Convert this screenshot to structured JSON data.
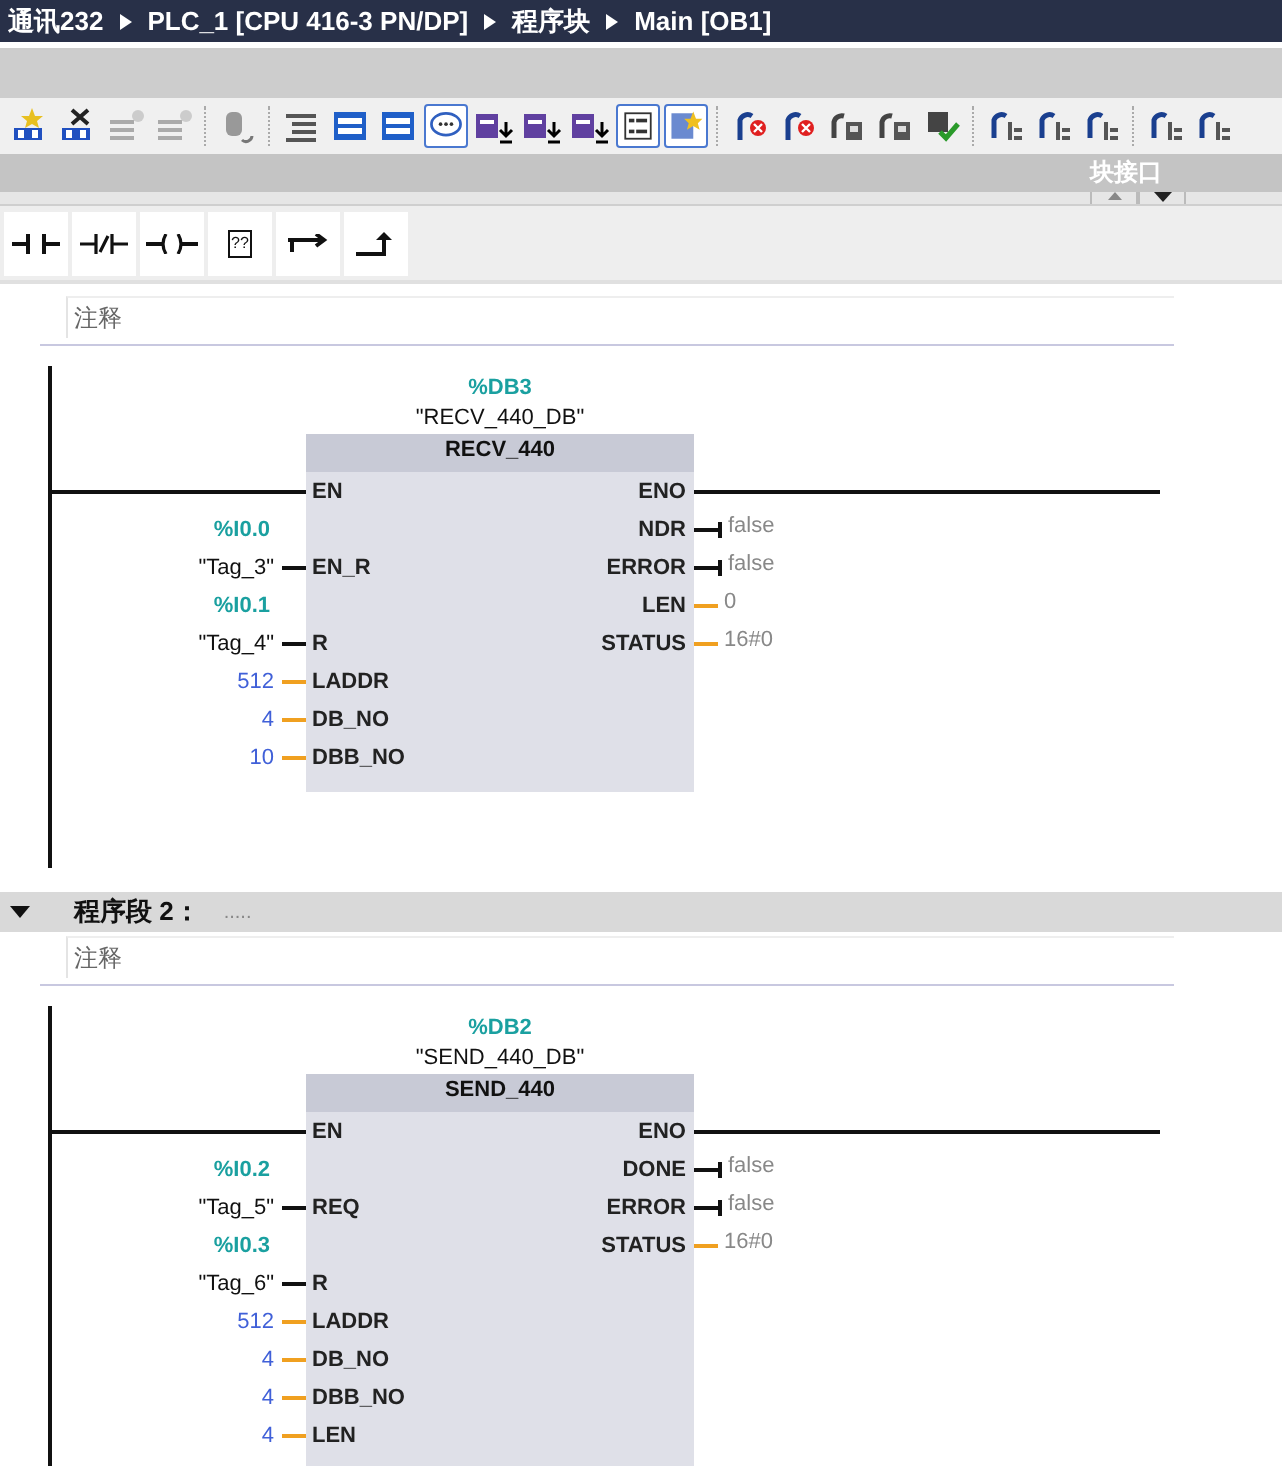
{
  "breadcrumb": [
    "通讯232",
    "PLC_1 [CPU 416-3 PN/DP]",
    "程序块",
    "Main [OB1]"
  ],
  "interface_label": "块接口",
  "palette": [
    {
      "kind": "no-contact"
    },
    {
      "kind": "nc-contact"
    },
    {
      "kind": "coil"
    },
    {
      "kind": "box",
      "label": "??"
    },
    {
      "kind": "branch-open"
    },
    {
      "kind": "branch-close"
    }
  ],
  "networks": [
    {
      "comment": "注释",
      "block": {
        "instance_address": "%DB3",
        "instance_name": "\"RECV_440_DB\"",
        "name": "RECV_440",
        "inputs": [
          {
            "pin": "EN",
            "kind": "rung"
          },
          {
            "pin": "EN_R",
            "kind": "bool",
            "address": "%I0.0",
            "operand": "\"Tag_3\""
          },
          {
            "pin": "R",
            "kind": "bool",
            "address": "%I0.1",
            "operand": "\"Tag_4\""
          },
          {
            "pin": "LADDR",
            "kind": "word",
            "operand": "512"
          },
          {
            "pin": "DB_NO",
            "kind": "word",
            "operand": "4"
          },
          {
            "pin": "DBB_NO",
            "kind": "word",
            "operand": "10"
          }
        ],
        "outputs": [
          {
            "pin": "ENO",
            "kind": "rung"
          },
          {
            "pin": "NDR",
            "kind": "bool",
            "operand": "false"
          },
          {
            "pin": "ERROR",
            "kind": "bool",
            "operand": "false"
          },
          {
            "pin": "LEN",
            "kind": "word",
            "operand": "0"
          },
          {
            "pin": "STATUS",
            "kind": "word",
            "operand": "16#0"
          }
        ]
      }
    },
    {
      "header": {
        "title": "程序段 2：",
        "title_comment": ".....",
        "expanded": true
      },
      "comment": "注释",
      "block": {
        "instance_address": "%DB2",
        "instance_name": "\"SEND_440_DB\"",
        "name": "SEND_440",
        "inputs": [
          {
            "pin": "EN",
            "kind": "rung"
          },
          {
            "pin": "REQ",
            "kind": "bool",
            "address": "%I0.2",
            "operand": "\"Tag_5\""
          },
          {
            "pin": "R",
            "kind": "bool",
            "address": "%I0.3",
            "operand": "\"Tag_6\""
          },
          {
            "pin": "LADDR",
            "kind": "word",
            "operand": "512"
          },
          {
            "pin": "DB_NO",
            "kind": "word",
            "operand": "4"
          },
          {
            "pin": "DBB_NO",
            "kind": "word",
            "operand": "4"
          },
          {
            "pin": "LEN",
            "kind": "word",
            "operand": "4"
          }
        ],
        "outputs": [
          {
            "pin": "ENO",
            "kind": "rung"
          },
          {
            "pin": "DONE",
            "kind": "bool",
            "operand": "false"
          },
          {
            "pin": "ERROR",
            "kind": "bool",
            "operand": "false"
          },
          {
            "pin": "STATUS",
            "kind": "word",
            "operand": "16#0"
          }
        ]
      }
    }
  ]
}
